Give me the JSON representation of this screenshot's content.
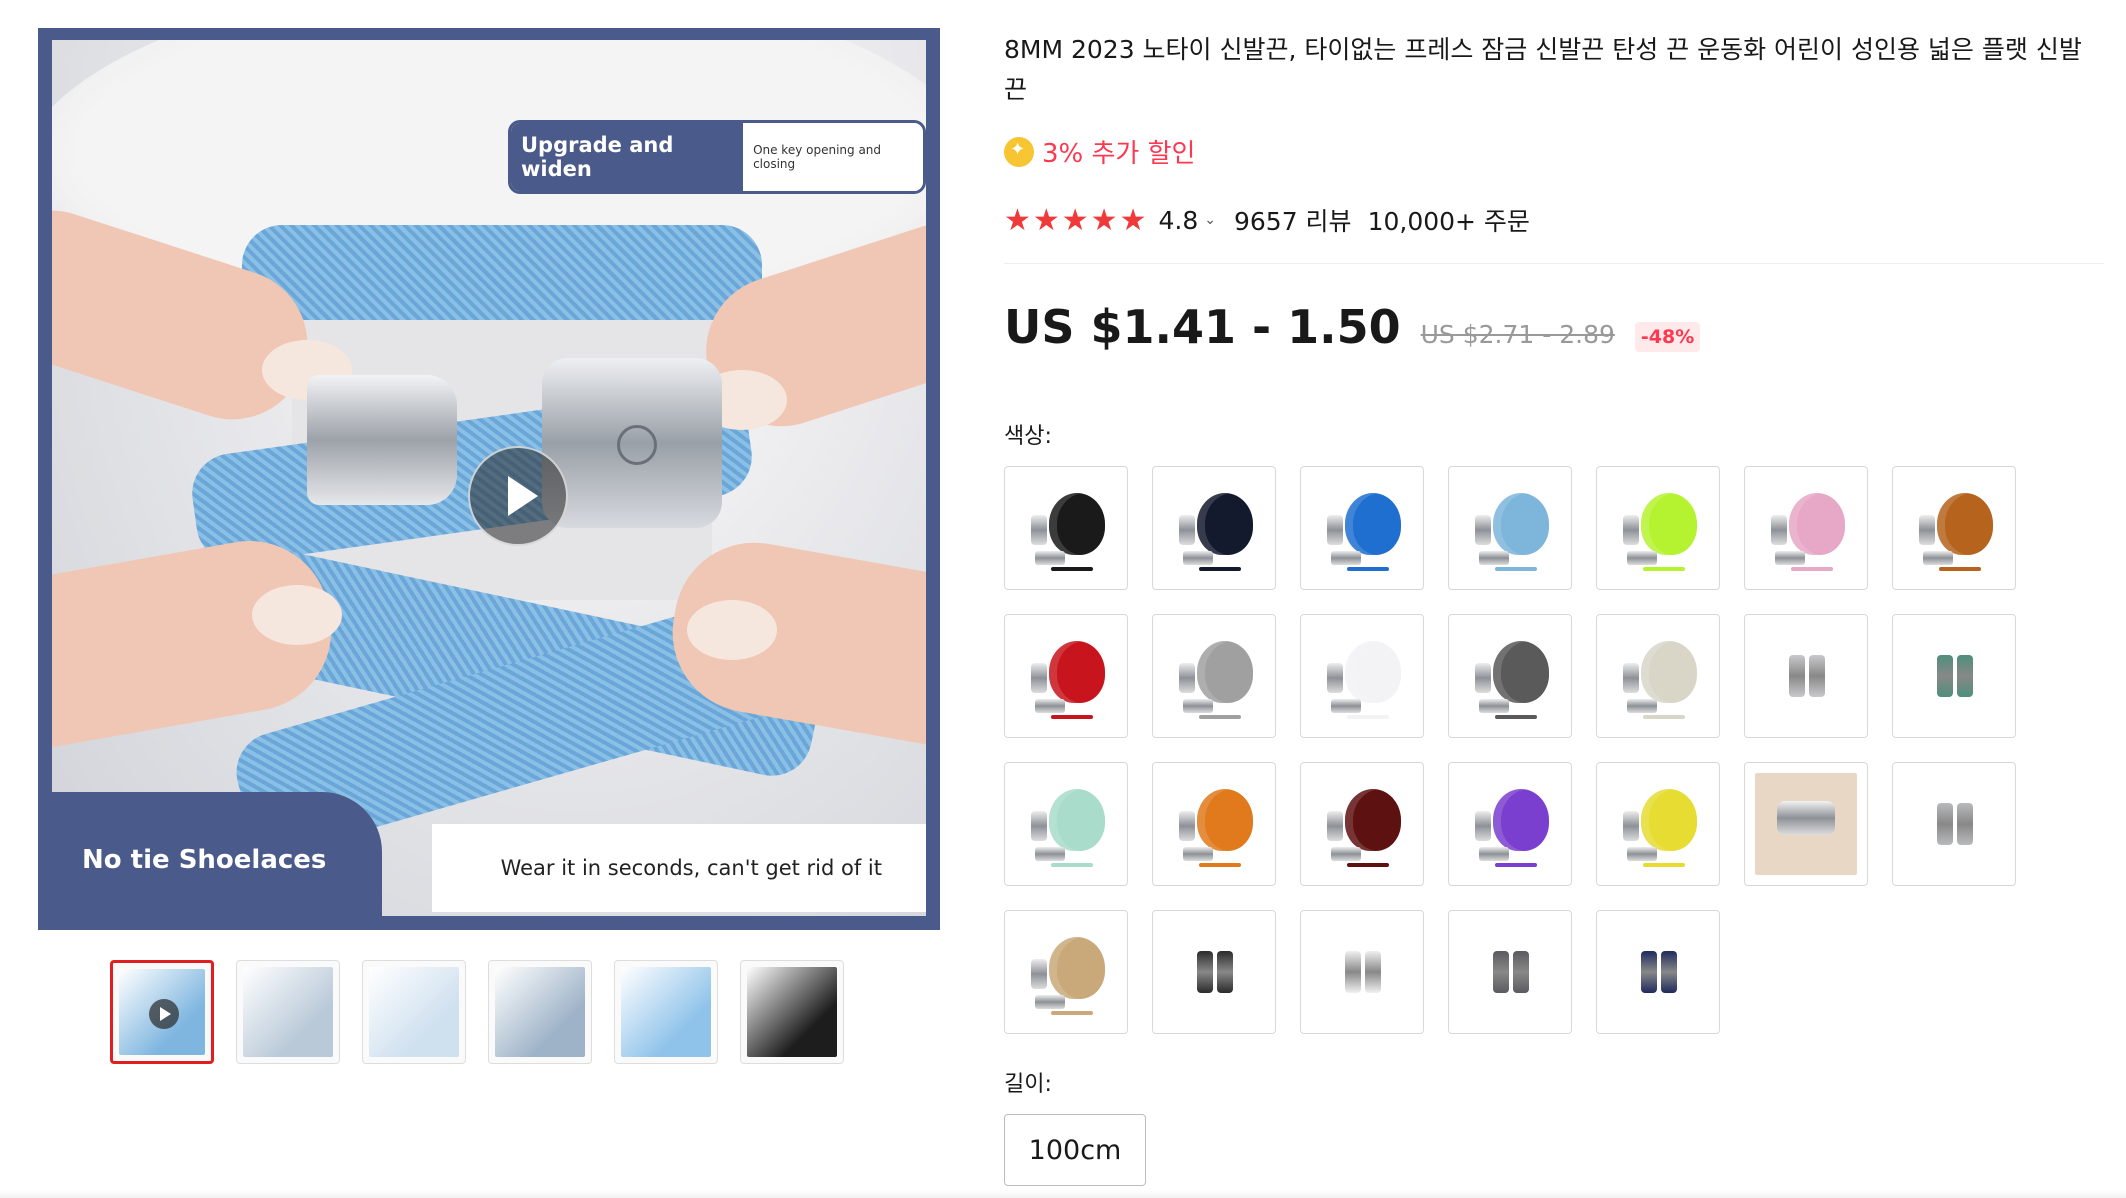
{
  "product": {
    "title": "8MM 2023 노타이 신발끈, 타이없는 프레스 잠금 신발끈 탄성 끈 운동화 어린이 성인용 넓은 플랫 신발끈",
    "extra_discount": "3% 추가 할인",
    "rating": "4.8",
    "reviews": "9657 리뷰",
    "orders": "10,000+ 주문",
    "price": "US $1.41 - 1.50",
    "original_price": "US $2.71 - 2.89",
    "discount": "-48%"
  },
  "gallery": {
    "badge_main": "Upgrade and widen",
    "badge_sub": "One key opening and closing",
    "caption_left": "No tie Shoelaces",
    "caption_right": "Wear it in seconds, can't get rid of it",
    "thumbnails": [
      {
        "color": "#7fb6e0"
      },
      {
        "color": "#b9c9d8"
      },
      {
        "color": "#cfe0ef"
      },
      {
        "color": "#9fb3c8"
      },
      {
        "color": "#8fc3ea"
      },
      {
        "color": "#1d1d1d"
      }
    ]
  },
  "options": {
    "color_label": "색상:",
    "length_label": "길이:",
    "length_value": "100cm",
    "swatches": [
      {
        "type": "lace",
        "color": "#1a1a1a"
      },
      {
        "type": "lace",
        "color": "#141a2e"
      },
      {
        "type": "lace",
        "color": "#1f6fd0"
      },
      {
        "type": "lace",
        "color": "#7db6da"
      },
      {
        "type": "lace",
        "color": "#b5f230"
      },
      {
        "type": "lace",
        "color": "#e7a7c6"
      },
      {
        "type": "lace",
        "color": "#b5631d"
      },
      {
        "type": "lace",
        "color": "#c8141c"
      },
      {
        "type": "lace",
        "color": "#a0a0a0"
      },
      {
        "type": "lace",
        "color": "#f3f3f5"
      },
      {
        "type": "lace",
        "color": "#5a5a5a"
      },
      {
        "type": "lace",
        "color": "#d9d6c8"
      },
      {
        "type": "buckle",
        "color": "#c9c9cc"
      },
      {
        "type": "buckle",
        "color": "#4e8f7b"
      },
      {
        "type": "lace",
        "color": "#a9dccb"
      },
      {
        "type": "lace",
        "color": "#e07a1c"
      },
      {
        "type": "lace",
        "color": "#5e1111"
      },
      {
        "type": "lace",
        "color": "#7b3fd0"
      },
      {
        "type": "lace",
        "color": "#e6dc32"
      },
      {
        "type": "photo",
        "color": "#e9d7c6"
      },
      {
        "type": "buckle",
        "color": "#b9babd"
      },
      {
        "type": "lace",
        "color": "#c9a97a"
      },
      {
        "type": "buckle",
        "color": "#2b2b2b"
      },
      {
        "type": "buckle",
        "color": "#f0f0f2"
      },
      {
        "type": "buckle",
        "color": "#5b5b5e"
      },
      {
        "type": "buckle",
        "color": "#1f2a5c"
      }
    ]
  }
}
